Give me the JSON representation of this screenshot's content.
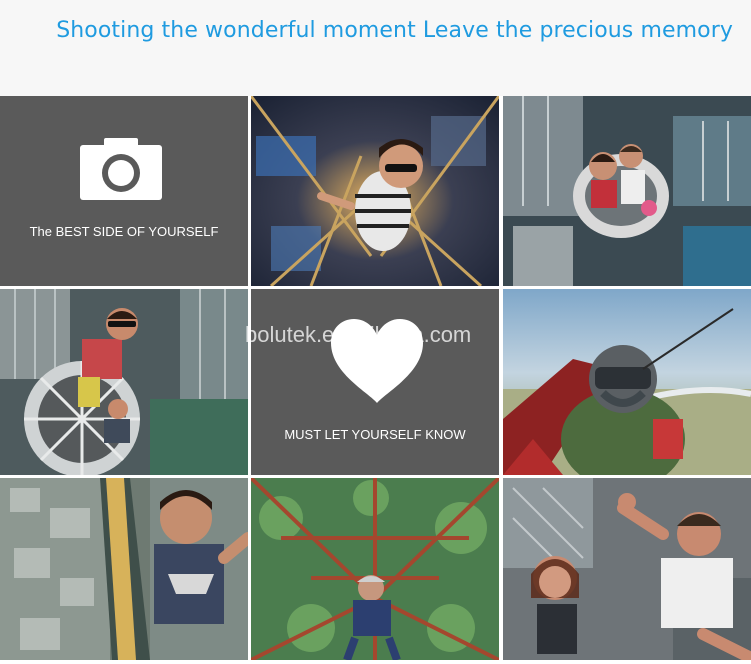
{
  "header": {
    "headline": "Shooting the wonderful moment Leave the precious memory"
  },
  "tiles": {
    "best_side_caption": "The BEST SIDE OF YOURSELF",
    "know_caption": "MUST LET YOURSELF KNOW"
  },
  "watermark": "bolutek.en.alibaba.com",
  "icons": {
    "camera": "camera-icon",
    "heart": "heart-icon"
  },
  "colors": {
    "headline": "#1f9be0",
    "tile_background": "#5a5a5a"
  }
}
